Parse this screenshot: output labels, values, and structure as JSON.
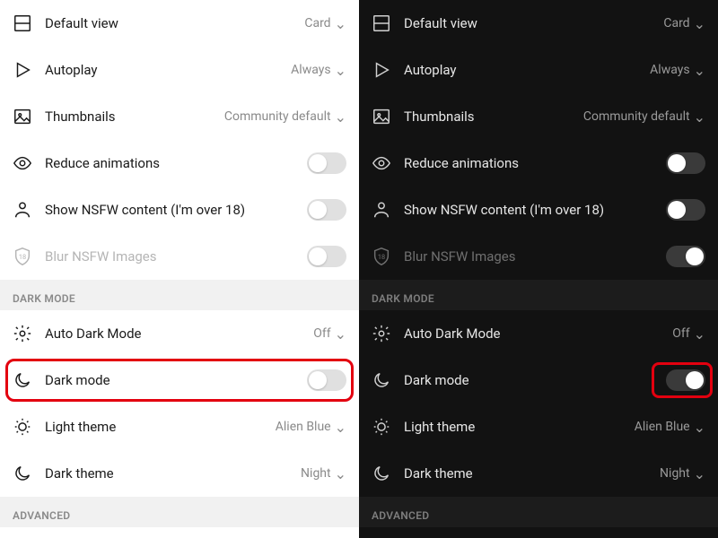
{
  "rows": {
    "default_view": {
      "label": "Default view",
      "value": "Card"
    },
    "autoplay": {
      "label": "Autoplay",
      "value": "Always"
    },
    "thumbnails": {
      "label": "Thumbnails",
      "value": "Community default"
    },
    "reduce_anim": {
      "label": "Reduce animations"
    },
    "show_nsfw": {
      "label": "Show NSFW content (I'm over 18)"
    },
    "blur_nsfw": {
      "label": "Blur NSFW Images"
    },
    "auto_dark": {
      "label": "Auto Dark Mode",
      "value": "Off"
    },
    "dark_mode": {
      "label": "Dark mode"
    },
    "light_theme": {
      "label": "Light theme",
      "value": "Alien Blue"
    },
    "dark_theme": {
      "label": "Dark theme",
      "value": "Night"
    }
  },
  "sections": {
    "dark_mode": "DARK MODE",
    "advanced": "ADVANCED"
  },
  "toggles": {
    "light": {
      "reduce_anim": false,
      "show_nsfw": false,
      "blur_nsfw": false,
      "dark_mode": false
    },
    "dark": {
      "reduce_anim": false,
      "show_nsfw": false,
      "blur_nsfw": true,
      "dark_mode": true
    }
  }
}
